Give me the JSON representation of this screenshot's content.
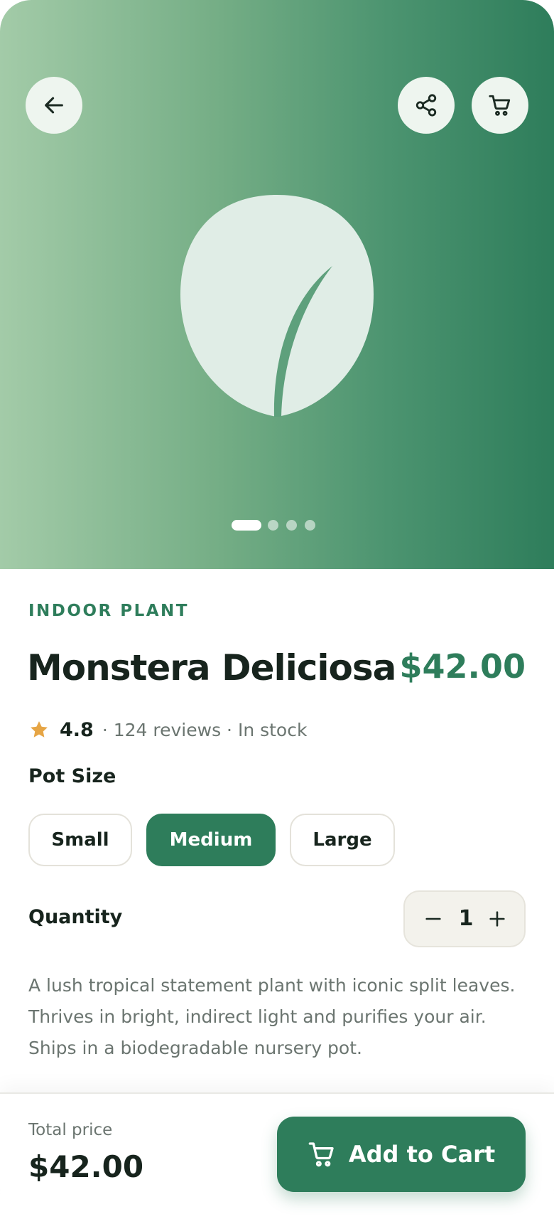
{
  "colors": {
    "accent": "#2e7d5b",
    "hero_gradient_start": "#a3cba8",
    "hero_gradient_end": "#2e7d5b",
    "star": "#e6a545",
    "muted_text": "#6b7570"
  },
  "header": {
    "back_icon": "arrow-left-icon",
    "share_icon": "share-icon",
    "cart_icon": "cart-icon"
  },
  "gallery": {
    "image_icon": "leaf-icon",
    "slide_count": 4,
    "active_slide": 1
  },
  "product": {
    "category": "INDOOR PLANT",
    "name": "Monstera Deliciosa",
    "price": "$42.00",
    "rating": "4.8",
    "meta": "· 124 reviews · In stock",
    "description": "A lush tropical statement plant with iconic split leaves. Thrives in bright, indirect light and purifies your air. Ships in a biodegradable nursery pot."
  },
  "pot_size": {
    "label": "Pot Size",
    "options": [
      "Small",
      "Medium",
      "Large"
    ],
    "selected": "Medium"
  },
  "quantity": {
    "label": "Quantity",
    "value": "1"
  },
  "footer": {
    "total_label": "Total price",
    "total_value": "$42.00",
    "cta_label": "Add to Cart",
    "cta_icon": "cart-icon"
  }
}
